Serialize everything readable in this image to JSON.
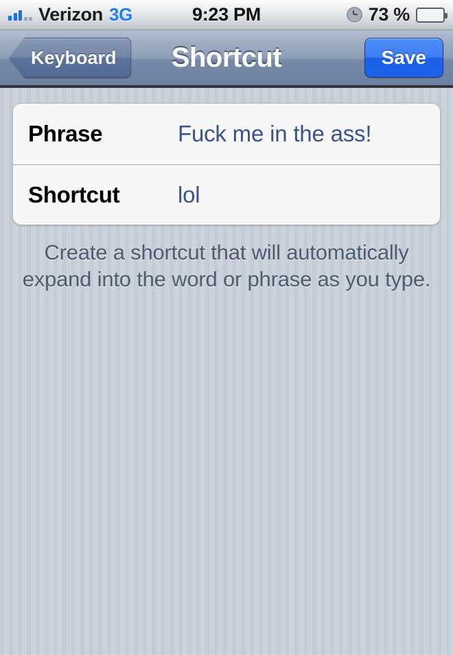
{
  "status_bar": {
    "carrier": "Verizon",
    "network": "3G",
    "time": "9:23 PM",
    "battery_percent": "73 %",
    "battery_level": 73,
    "signal_bars_filled": 3,
    "signal_bars_total": 5,
    "icons": {
      "signal": "signal-bars-icon",
      "clock": "alarm-clock-icon",
      "battery": "battery-icon"
    }
  },
  "nav_bar": {
    "back_label": "Keyboard",
    "title": "Shortcut",
    "save_label": "Save"
  },
  "form": {
    "rows": [
      {
        "label": "Phrase",
        "value": "Fuck me in the ass!"
      },
      {
        "label": "Shortcut",
        "value": "lol"
      }
    ]
  },
  "footer": {
    "note": "Create a shortcut that will automatically expand into the word or phrase as you type."
  },
  "colors": {
    "accent_blue": "#1f63ea",
    "value_text": "#3a5488",
    "navbar_top": "#b4c0d1",
    "navbar_bottom": "#6d82a2",
    "background": "#c5ccd5"
  }
}
